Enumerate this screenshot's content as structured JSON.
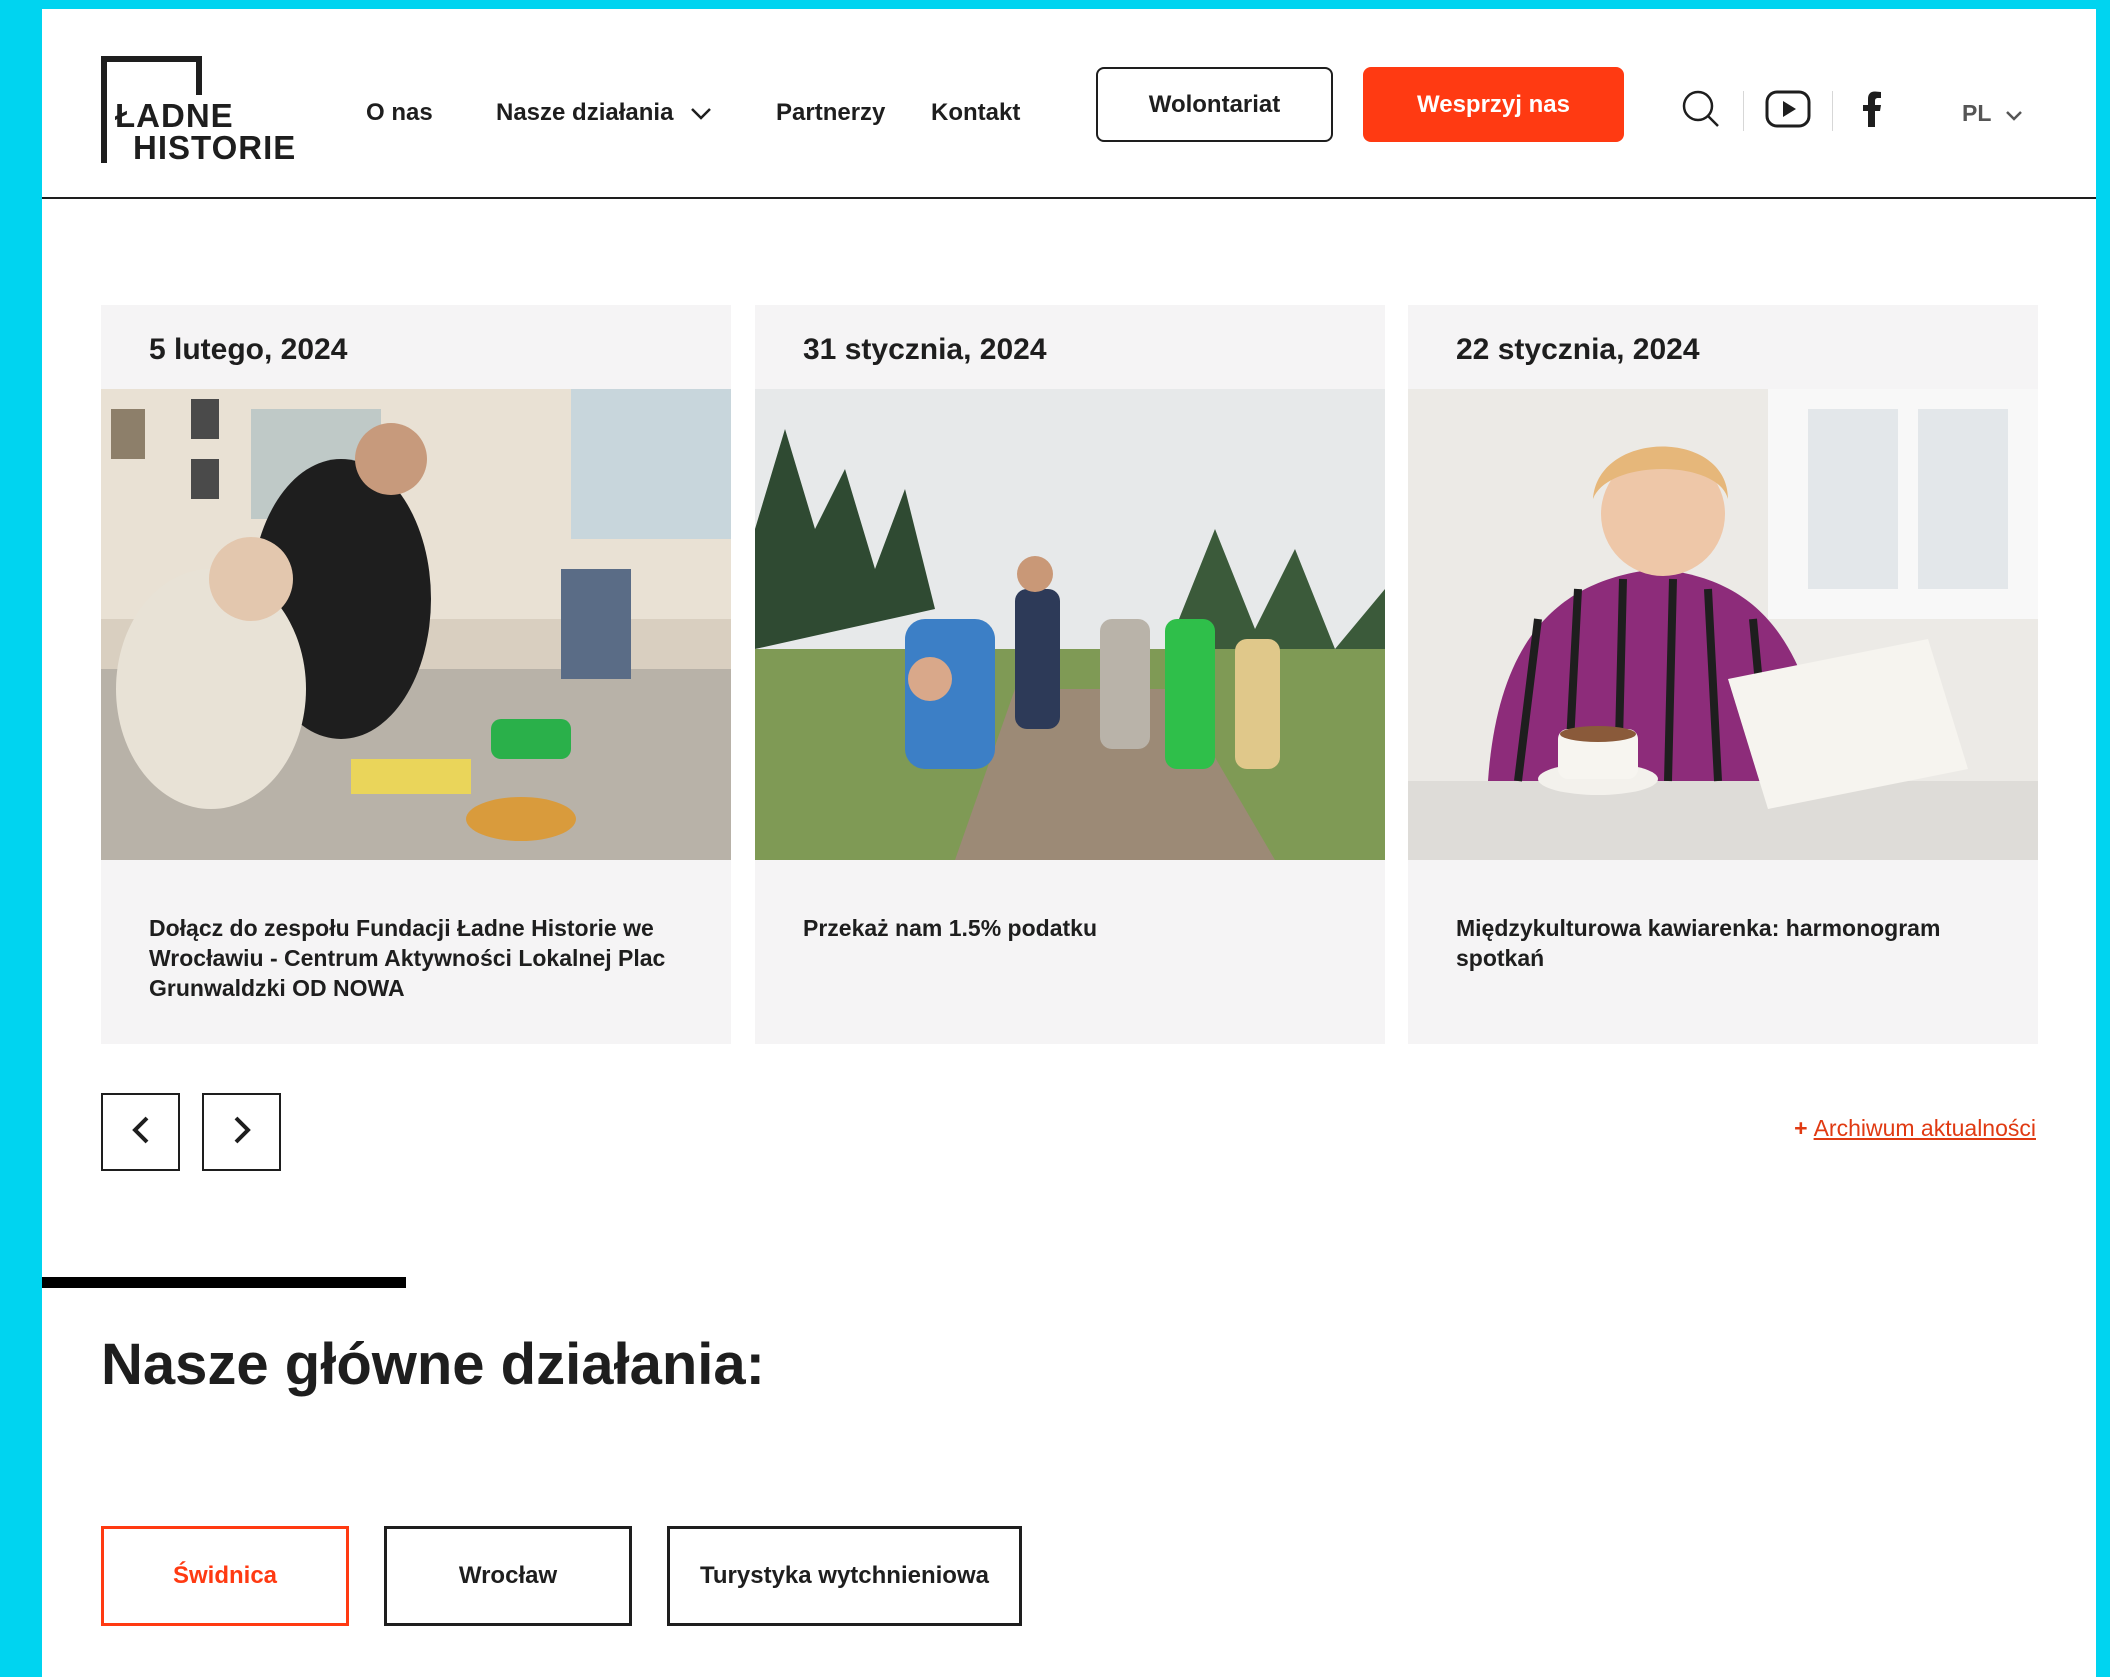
{
  "header": {
    "logo": {
      "line1": "ŁADNE",
      "line2": "HISTORIE"
    },
    "nav": [
      {
        "label": "O nas"
      },
      {
        "label": "Nasze działania"
      },
      {
        "label": "Partnerzy"
      },
      {
        "label": "Kontakt"
      }
    ],
    "volunteer_button": "Wolontariat",
    "support_button": "Wesprzyj nas",
    "language": "PL",
    "icons": [
      "search-icon",
      "youtube-icon",
      "facebook-icon",
      "chevron-down-icon"
    ]
  },
  "news": {
    "cards": [
      {
        "date": "5 lutego, 2024",
        "title": "Dołącz do zespołu Fundacji Ładne Historie we Wrocławiu - Centrum Aktywności Lokalnej Plac Grunwaldzki OD NOWA"
      },
      {
        "date": "31 stycznia, 2024",
        "title": "Przekaż nam 1.5% podatku"
      },
      {
        "date": "22 stycznia, 2024",
        "title": "Międzykulturowa kawiarenka: harmonogram spotkań"
      }
    ],
    "archive_plus": "+",
    "archive_label": "Archiwum aktualności"
  },
  "activities": {
    "title": "Nasze główne działania:",
    "tabs": [
      {
        "label": "Świdnica",
        "active": true
      },
      {
        "label": "Wrocław",
        "active": false
      },
      {
        "label": "Turystyka wytchnieniowa",
        "active": false
      }
    ]
  },
  "colors": {
    "accent": "#ff3a12",
    "frame": "#00d4f0",
    "card_bg": "#f5f4f5",
    "text": "#1e1e1e"
  }
}
